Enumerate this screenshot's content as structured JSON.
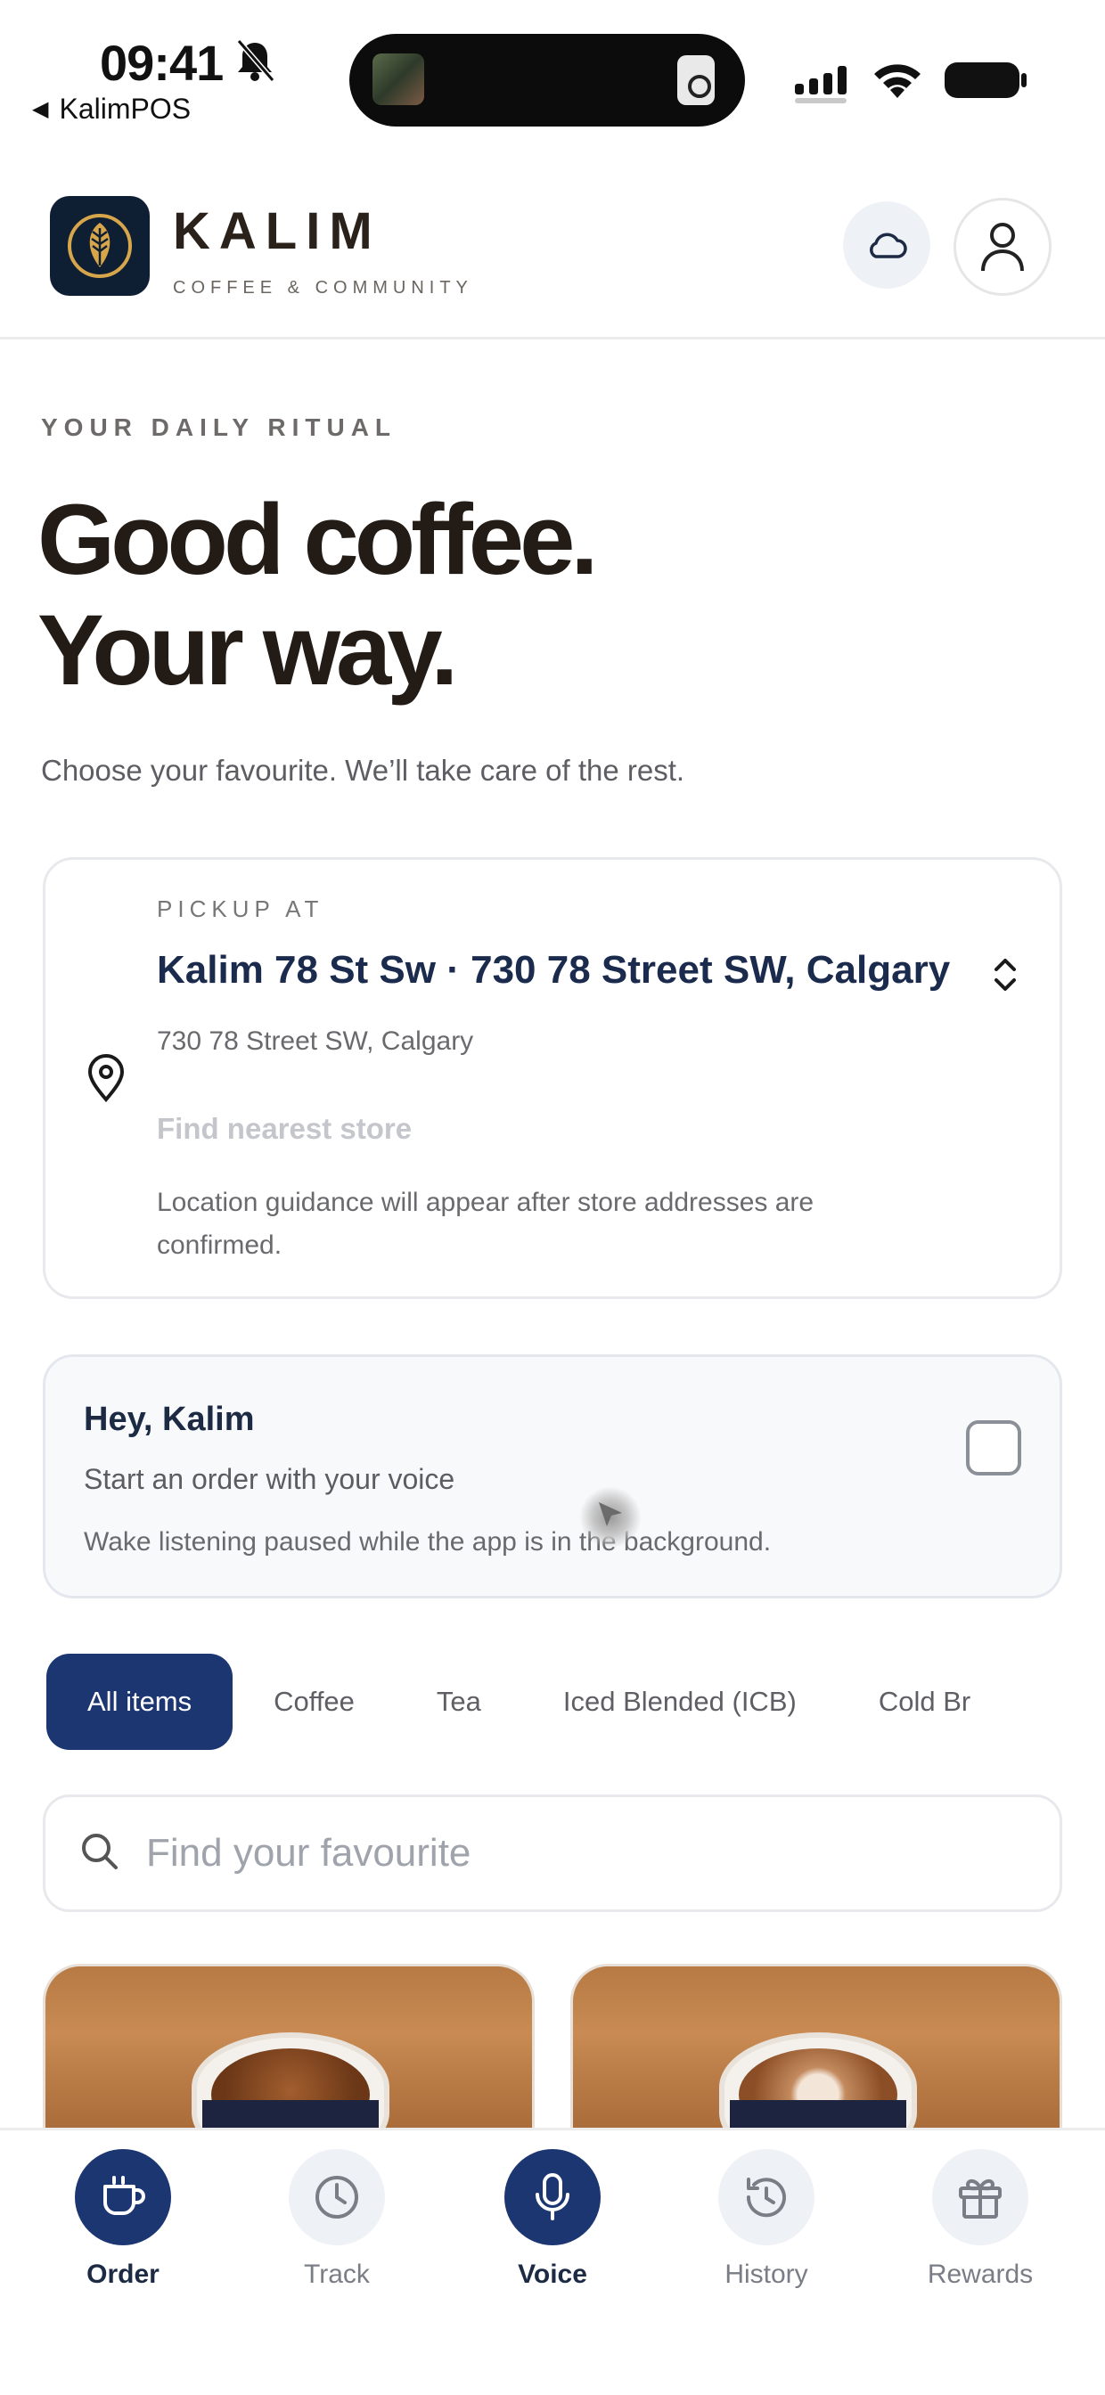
{
  "status_bar": {
    "time": "09:41",
    "back_label": "KalimPOS"
  },
  "header": {
    "brand": "KALIM",
    "tagline": "COFFEE & COMMUNITY"
  },
  "hero": {
    "eyebrow": "YOUR DAILY RITUAL",
    "line1": "Good coffee.",
    "line2": "Your way.",
    "subtitle": "Choose your favourite. We’ll take care of the rest."
  },
  "pickup": {
    "label": "PICKUP AT",
    "store": "Kalim 78 St Sw · 730 78 Street SW, Calgary",
    "address": "730 78 Street SW, Calgary",
    "find_nearest": "Find nearest store",
    "note": "Location guidance will appear after store addresses are confirmed."
  },
  "voice": {
    "title": "Hey, Kalim",
    "subtitle": "Start an order with your voice",
    "note": "Wake listening paused while the app is in the background."
  },
  "categories": [
    "All items",
    "Coffee",
    "Tea",
    "Iced Blended (ICB)",
    "Cold Br"
  ],
  "search": {
    "placeholder": "Find your favourite"
  },
  "tabs": [
    {
      "label": "Order",
      "icon": "cup-icon",
      "active": true
    },
    {
      "label": "Track",
      "icon": "clock-icon",
      "active": false
    },
    {
      "label": "Voice",
      "icon": "microphone-icon",
      "active": true
    },
    {
      "label": "History",
      "icon": "history-icon",
      "active": false
    },
    {
      "label": "Rewards",
      "icon": "gift-icon",
      "active": false
    }
  ],
  "colors": {
    "primary": "#1c3672",
    "logo_bg": "#0f1f33",
    "gold": "#d8a64a"
  }
}
